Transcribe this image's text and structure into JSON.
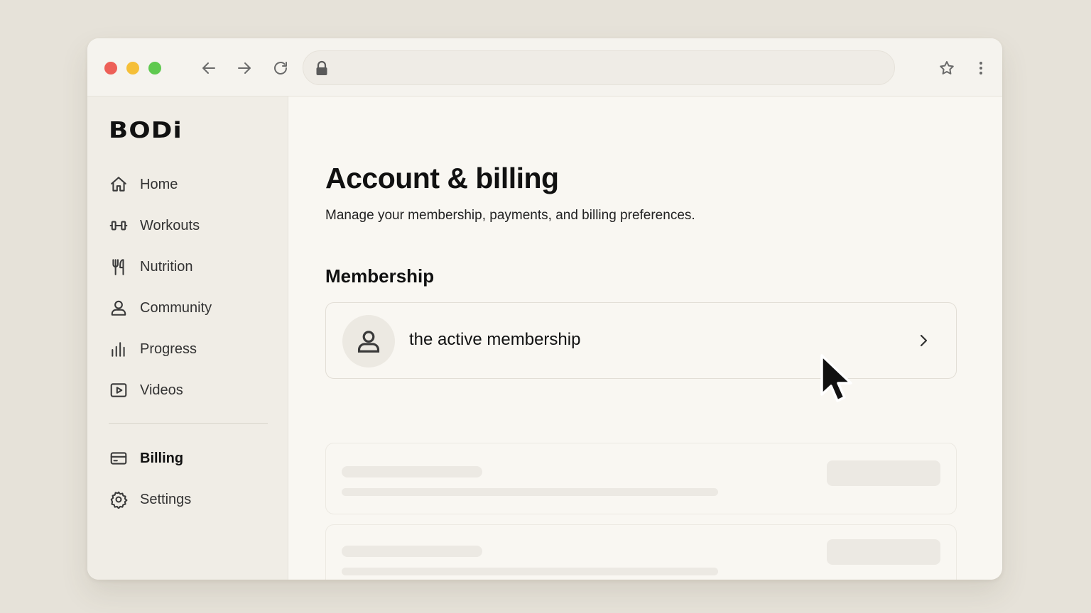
{
  "browser": {
    "url": "",
    "icons": {
      "back": "arrow-left-icon",
      "forward": "arrow-right-icon",
      "reload": "reload-icon",
      "lock": "lock-icon",
      "bookmark": "star-icon",
      "menu": "kebab-menu-icon"
    },
    "traffic_lights": {
      "close": "#ed5f57",
      "minimize": "#f5bf38",
      "maximize": "#5fc94f"
    }
  },
  "sidebar": {
    "logo": "BODi",
    "items": [
      {
        "label": "Home",
        "icon": "home-icon"
      },
      {
        "label": "Workouts",
        "icon": "dumbbell-icon"
      },
      {
        "label": "Nutrition",
        "icon": "fork-knife-icon"
      },
      {
        "label": "Community",
        "icon": "person-icon"
      },
      {
        "label": "Progress",
        "icon": "bar-chart-icon"
      },
      {
        "label": "Videos",
        "icon": "video-play-icon"
      }
    ],
    "secondary_items": [
      {
        "label": "Billing",
        "icon": "credit-card-icon",
        "active": true
      },
      {
        "label": "Settings",
        "icon": "gear-icon"
      }
    ]
  },
  "main": {
    "title": "Account & billing",
    "subtitle": "Manage your membership, payments, and billing preferences.",
    "section_title": "Membership",
    "membership_card": {
      "label": "the active membership",
      "icon": "person-icon"
    }
  },
  "colors": {
    "background": "#e6e2d9",
    "window": "#f9f7f2",
    "sidebar": "#f0ede6"
  }
}
